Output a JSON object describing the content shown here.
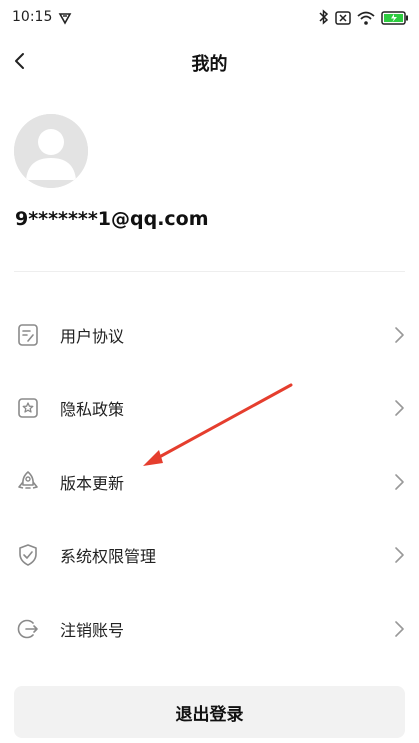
{
  "status_bar": {
    "time": "10:15",
    "icons": [
      "vpn-icon",
      "bluetooth-icon",
      "sim-off-icon",
      "wifi-icon",
      "battery-charging-icon"
    ],
    "battery_color": "#2ecc40"
  },
  "header": {
    "title": "我的"
  },
  "profile": {
    "account": "9*******1@qq.com"
  },
  "menu": {
    "items": [
      {
        "label": "用户协议",
        "icon": "document-edit-icon"
      },
      {
        "label": "隐私政策",
        "icon": "star-shield-icon"
      },
      {
        "label": "版本更新",
        "icon": "rocket-icon"
      },
      {
        "label": "系统权限管理",
        "icon": "shield-check-icon"
      },
      {
        "label": "注销账号",
        "icon": "logout-circle-icon"
      }
    ]
  },
  "logout": {
    "label": "退出登录"
  },
  "colors": {
    "icon_gray": "#8a8a8a",
    "annotation_arrow": "#e53e2e",
    "button_bg": "#f2f2f2"
  }
}
